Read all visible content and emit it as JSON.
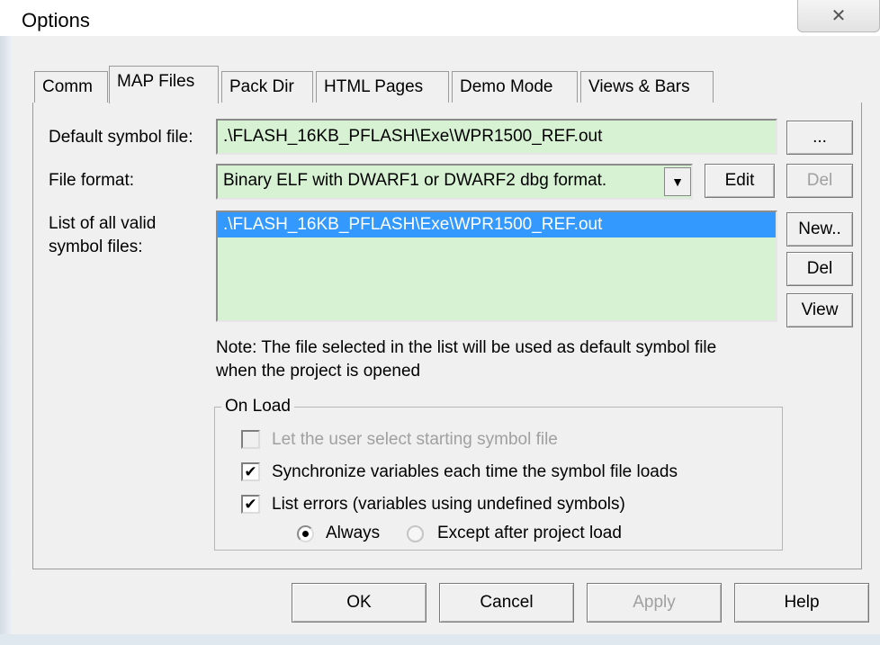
{
  "window": {
    "title": "Options",
    "close_glyph": "✕"
  },
  "tabs": [
    {
      "label": "Comm"
    },
    {
      "label": "MAP Files"
    },
    {
      "label": "Pack Dir"
    },
    {
      "label": "HTML Pages"
    },
    {
      "label": "Demo Mode"
    },
    {
      "label": "Views & Bars"
    }
  ],
  "map_files": {
    "default_symbol_label": "Default symbol file:",
    "default_symbol_value": ".\\FLASH_16KB_PFLASH\\Exe\\WPR1500_REF.out",
    "browse_label": "...",
    "file_format_label": "File format:",
    "file_format_value": "Binary ELF with DWARF1 or DWARF2 dbg format.",
    "edit_label": "Edit",
    "del_format_label": "Del",
    "list_label_line1": "List of all valid",
    "list_label_line2": "symbol files:",
    "symbol_files": [
      ".\\FLASH_16KB_PFLASH\\Exe\\WPR1500_REF.out"
    ],
    "new_label": "New..",
    "del_label": "Del",
    "view_label": "View",
    "note_line1": "Note: The file selected in the list will be used as default symbol file",
    "note_line2": "when the project is opened"
  },
  "on_load": {
    "title": "On Load",
    "let_user_select": {
      "label": "Let the user select starting symbol file",
      "checked": false,
      "enabled": false
    },
    "sync_variables": {
      "label": "Synchronize variables each time the symbol file loads",
      "checked": true
    },
    "list_errors": {
      "label": "List errors (variables using undefined symbols)",
      "checked": true
    },
    "always_label": "Always",
    "except_label": "Except after project load",
    "selected": "Always"
  },
  "footer": {
    "ok": "OK",
    "cancel": "Cancel",
    "apply": "Apply",
    "help": "Help"
  },
  "colors": {
    "field_bg": "#d6f2d2",
    "selection": "#3399ff",
    "dialog_bg": "#f0f0f0"
  }
}
